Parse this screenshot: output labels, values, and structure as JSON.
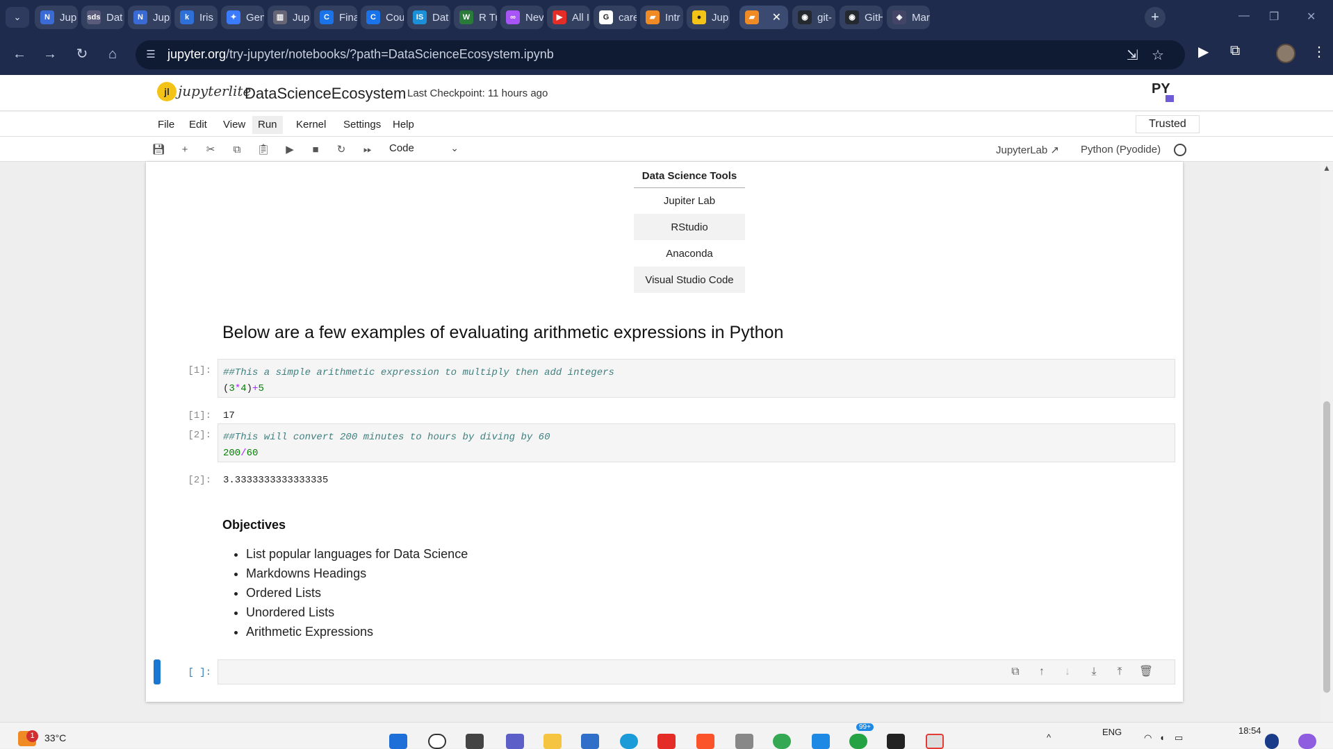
{
  "browser": {
    "tabs": [
      {
        "label": "Jup",
        "color": "#3a6ad4",
        "glyph": "N"
      },
      {
        "label": "Dat",
        "color": "#5a5a7a",
        "glyph": "sds"
      },
      {
        "label": "Jup",
        "color": "#3a6ad4",
        "glyph": "N"
      },
      {
        "label": "Iris",
        "color": "#2e6fd8",
        "glyph": "k"
      },
      {
        "label": "Gen",
        "color": "#3b7bff",
        "glyph": "✦"
      },
      {
        "label": "Jup",
        "color": "#666677",
        "glyph": "▥"
      },
      {
        "label": "Fina",
        "color": "#1a73e8",
        "glyph": "C"
      },
      {
        "label": "Cou",
        "color": "#1a73e8",
        "glyph": "C"
      },
      {
        "label": "Dat",
        "color": "#1b8fd8",
        "glyph": "IS"
      },
      {
        "label": "R Tu",
        "color": "#2a7a3a",
        "glyph": "W"
      },
      {
        "label": "Nev",
        "color": "#a855f7",
        "glyph": "∞"
      },
      {
        "label": "All I",
        "color": "#e52d27",
        "glyph": "▶"
      },
      {
        "label": "care",
        "color": "#ffffff",
        "glyph": "G"
      },
      {
        "label": "Intr",
        "color": "#f08a24",
        "glyph": "▰"
      },
      {
        "label": "Jup",
        "color": "#f3c318",
        "glyph": "●"
      },
      {
        "label": "",
        "color": "#f08a24",
        "glyph": "▰"
      },
      {
        "label": "git-",
        "color": "#24292f",
        "glyph": "◉"
      },
      {
        "label": "GitH",
        "color": "#24292f",
        "glyph": "◉"
      },
      {
        "label": "Mar",
        "color": "#444466",
        "glyph": "◈"
      }
    ],
    "new_tab": "+",
    "url_host": "jupyter.org",
    "url_path": "/try-jupyter/notebooks/?path=DataScienceEcosystem.ipynb"
  },
  "jupyter": {
    "logo_text": "jupyterlite",
    "notebook_title": "DataScienceEcosystem",
    "checkpoint": "Last Checkpoint: 11 hours ago",
    "py_logo": "PY",
    "menus": [
      "File",
      "Edit",
      "View",
      "Run",
      "Kernel",
      "Settings",
      "Help"
    ],
    "trusted": "Trusted",
    "cell_type": "Code",
    "jupyterlab_link": "JupyterLab",
    "kernel_name": "Python (Pyodide)"
  },
  "notebook": {
    "tools_table": {
      "header": "Data Science Tools",
      "rows": [
        "Jupiter Lab",
        "RStudio",
        "Anaconda",
        "Visual Studio Code"
      ]
    },
    "arith_heading": "Below are a few examples of evaluating arithmetic expressions in Python",
    "cell1": {
      "in_prompt": "[1]:",
      "comment": "##This a simple arithmetic expression to multiply then add integers",
      "code_open": "(",
      "code_a": "3",
      "code_op1": "*",
      "code_b": "4",
      "code_close": ")",
      "code_op2": "+",
      "code_c": "5",
      "out_prompt": "[1]:",
      "output": "17"
    },
    "cell2": {
      "in_prompt": "[2]:",
      "comment": "##This will convert 200 minutes to hours by diving by 60",
      "code_a": "200",
      "code_op": "/",
      "code_b": "60",
      "out_prompt": "[2]:",
      "output": "3.3333333333333335"
    },
    "objectives_heading": "Objectives",
    "objectives": [
      "List popular languages for Data Science",
      "Markdowns Headings",
      "Ordered Lists",
      "Unordered Lists",
      "Arithmetic Expressions"
    ],
    "empty_prompt": "[ ]:"
  },
  "taskbar": {
    "weather_temp": "33°C",
    "notif_count": "1",
    "badge_count": "99+",
    "lang": "ENG",
    "time": "18:54"
  }
}
